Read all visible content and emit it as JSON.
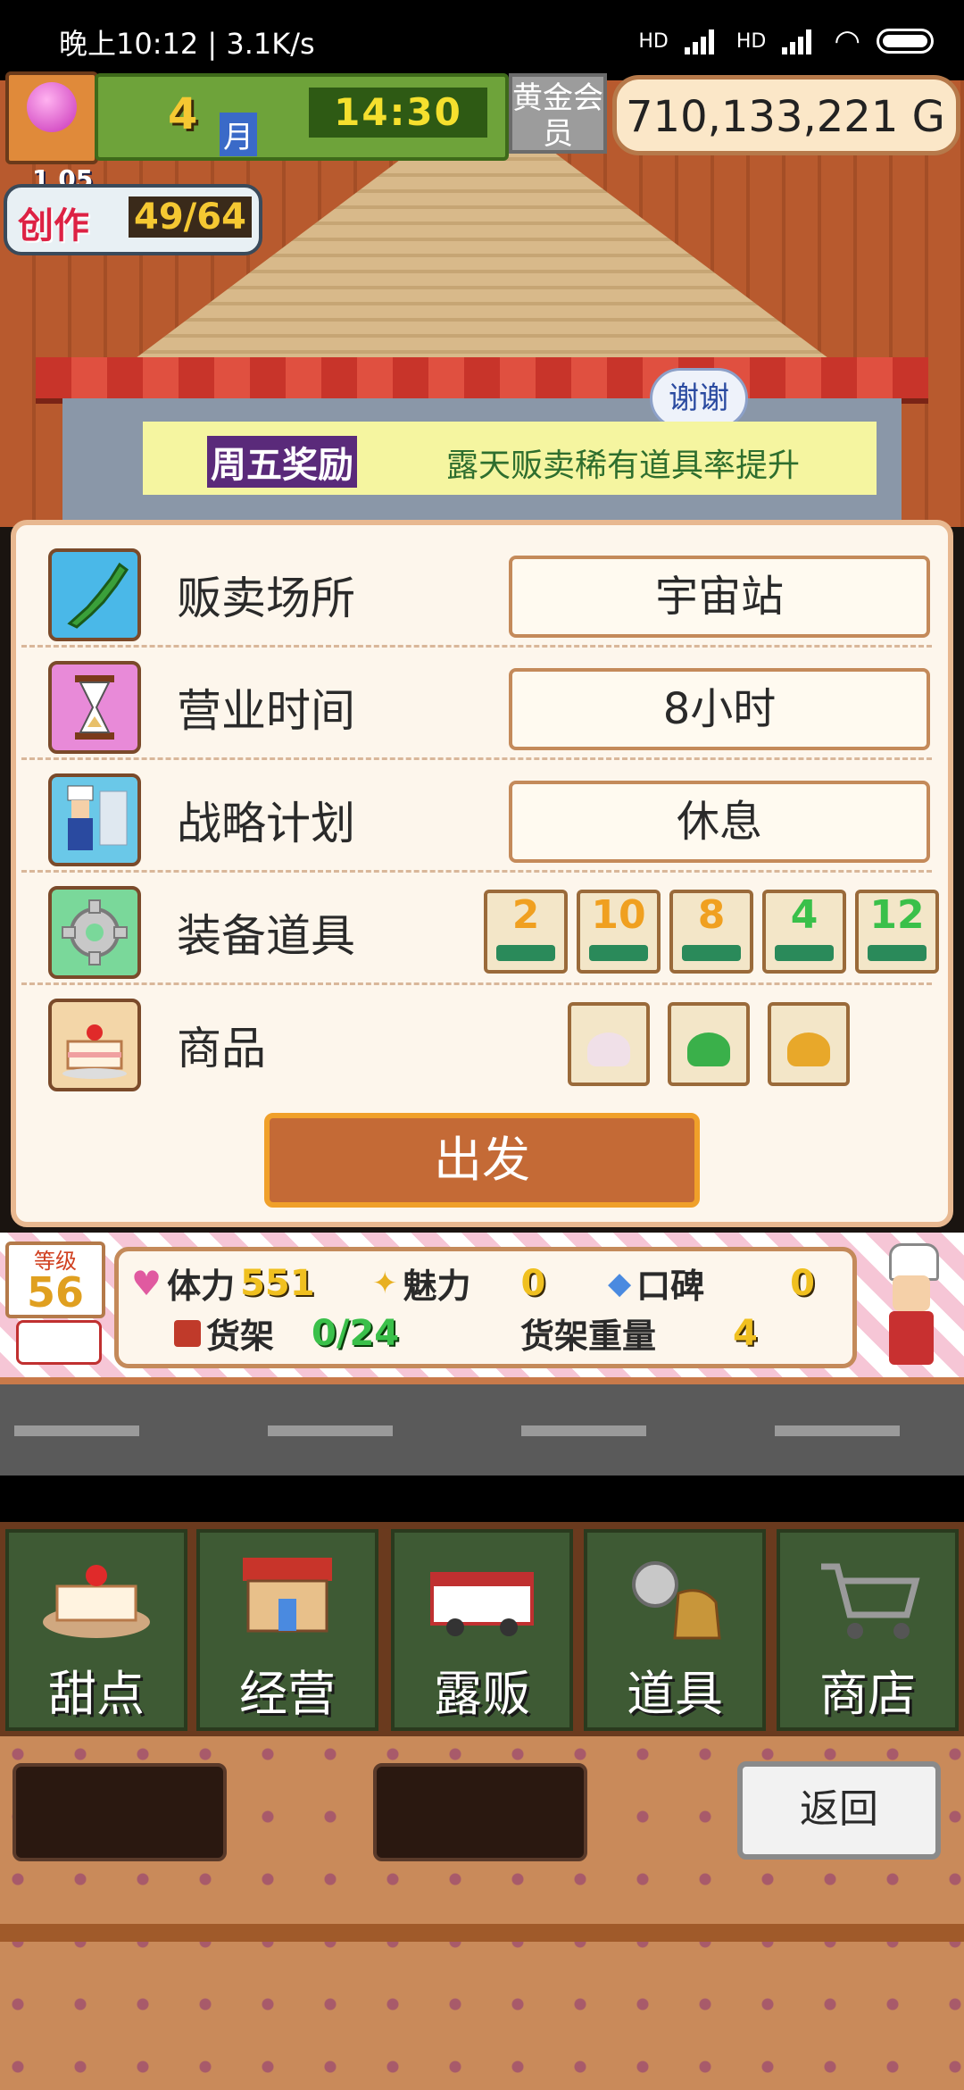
{
  "status_bar": {
    "time": "晚上10:12 | 3.1K/s",
    "network_1": "HD",
    "network_2": "HD"
  },
  "hud": {
    "month_number": "4",
    "month_label": "月",
    "clock": "14:30",
    "gold_member": "黄金会员",
    "money": "710,133,221 G",
    "create_label": "创作",
    "create_progress": "49/64",
    "create_level": "1 05"
  },
  "banner": {
    "title": "周五奖励",
    "text": "露天贩卖稀有道具率提升",
    "thanks": "谢谢"
  },
  "settings": {
    "location": {
      "label": "贩卖场所",
      "value": "宇宙站",
      "icon": "japan-map-icon"
    },
    "hours": {
      "label": "营业时间",
      "value": "8小时",
      "icon": "hourglass-icon"
    },
    "strategy": {
      "label": "战略计划",
      "value": "休息",
      "icon": "chef-icon"
    },
    "equipment": {
      "label": "装备道具",
      "icon": "gear-icon",
      "items": [
        "2",
        "10",
        "8",
        "4",
        "12"
      ]
    },
    "goods": {
      "label": "商品",
      "icon": "cake-icon",
      "items": [
        "cake-dessert-icon",
        "green-jelly-icon",
        "pudding-icon"
      ]
    }
  },
  "depart_label": "出发",
  "stats": {
    "level_label": "等级",
    "level": "56",
    "stamina_label": "体力",
    "stamina": "551",
    "charm_label": "魅力",
    "charm": "0",
    "reputation_label": "口碑",
    "reputation": "0",
    "shelf_label": "货架",
    "shelf": "0/24",
    "shelf_weight_label": "货架重量",
    "shelf_weight": "4"
  },
  "nav": [
    {
      "label": "甜点",
      "icon": "cake-icon"
    },
    {
      "label": "经营",
      "icon": "shop-icon"
    },
    {
      "label": "露贩",
      "icon": "food-truck-icon"
    },
    {
      "label": "道具",
      "icon": "tools-icon"
    },
    {
      "label": "商店",
      "icon": "cart-icon"
    }
  ],
  "back_label": "返回",
  "colors": {
    "accent": "#c46a36",
    "panel": "#fdf6ec",
    "nav_bg": "#3e5a34"
  }
}
